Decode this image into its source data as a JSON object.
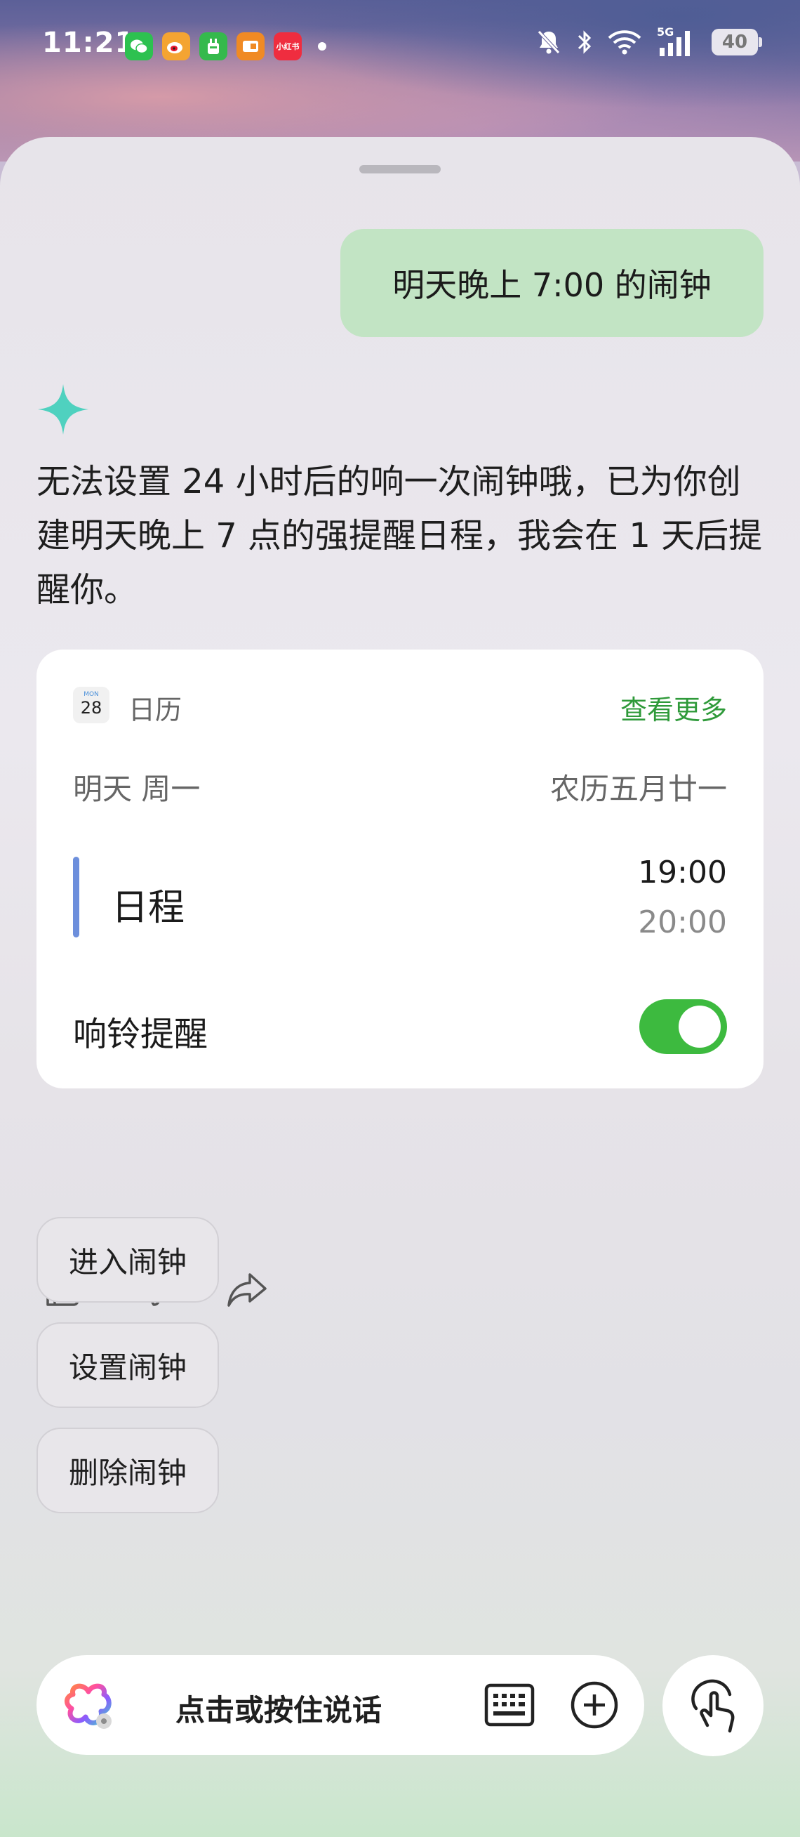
{
  "status_bar": {
    "time": "11:21",
    "battery": "40",
    "notification_apps": [
      "wechat-icon",
      "weibo-icon",
      "app-icon-green",
      "app-icon-orange",
      "xiaohongshu-icon"
    ],
    "xiaohongshu_label": "小红书",
    "network": "5G"
  },
  "conversation": {
    "user_message": "明天晚上 7:00 的闹钟",
    "assistant_reply": "无法设置 24 小时后的响一次闹钟哦，已为你创建明天晚上 7 点的强提醒日程，我会在 1 天后提醒你。"
  },
  "calendar_card": {
    "app_icon_month": "MON",
    "app_icon_day": "28",
    "app_name": "日历",
    "see_more": "查看更多",
    "date_label": "明天 周一",
    "lunar_date": "农历五月廿一",
    "event_title": "日程",
    "start_time": "19:00",
    "end_time": "20:00",
    "ring_reminder_label": "响铃提醒",
    "ring_reminder_on": true,
    "accent_color": "#2f9a3a",
    "event_color": "#6d8fdc"
  },
  "suggestions": [
    "进入闹钟",
    "设置闹钟",
    "删除闹钟"
  ],
  "input_bar": {
    "voice_label": "点击或按住说话"
  }
}
